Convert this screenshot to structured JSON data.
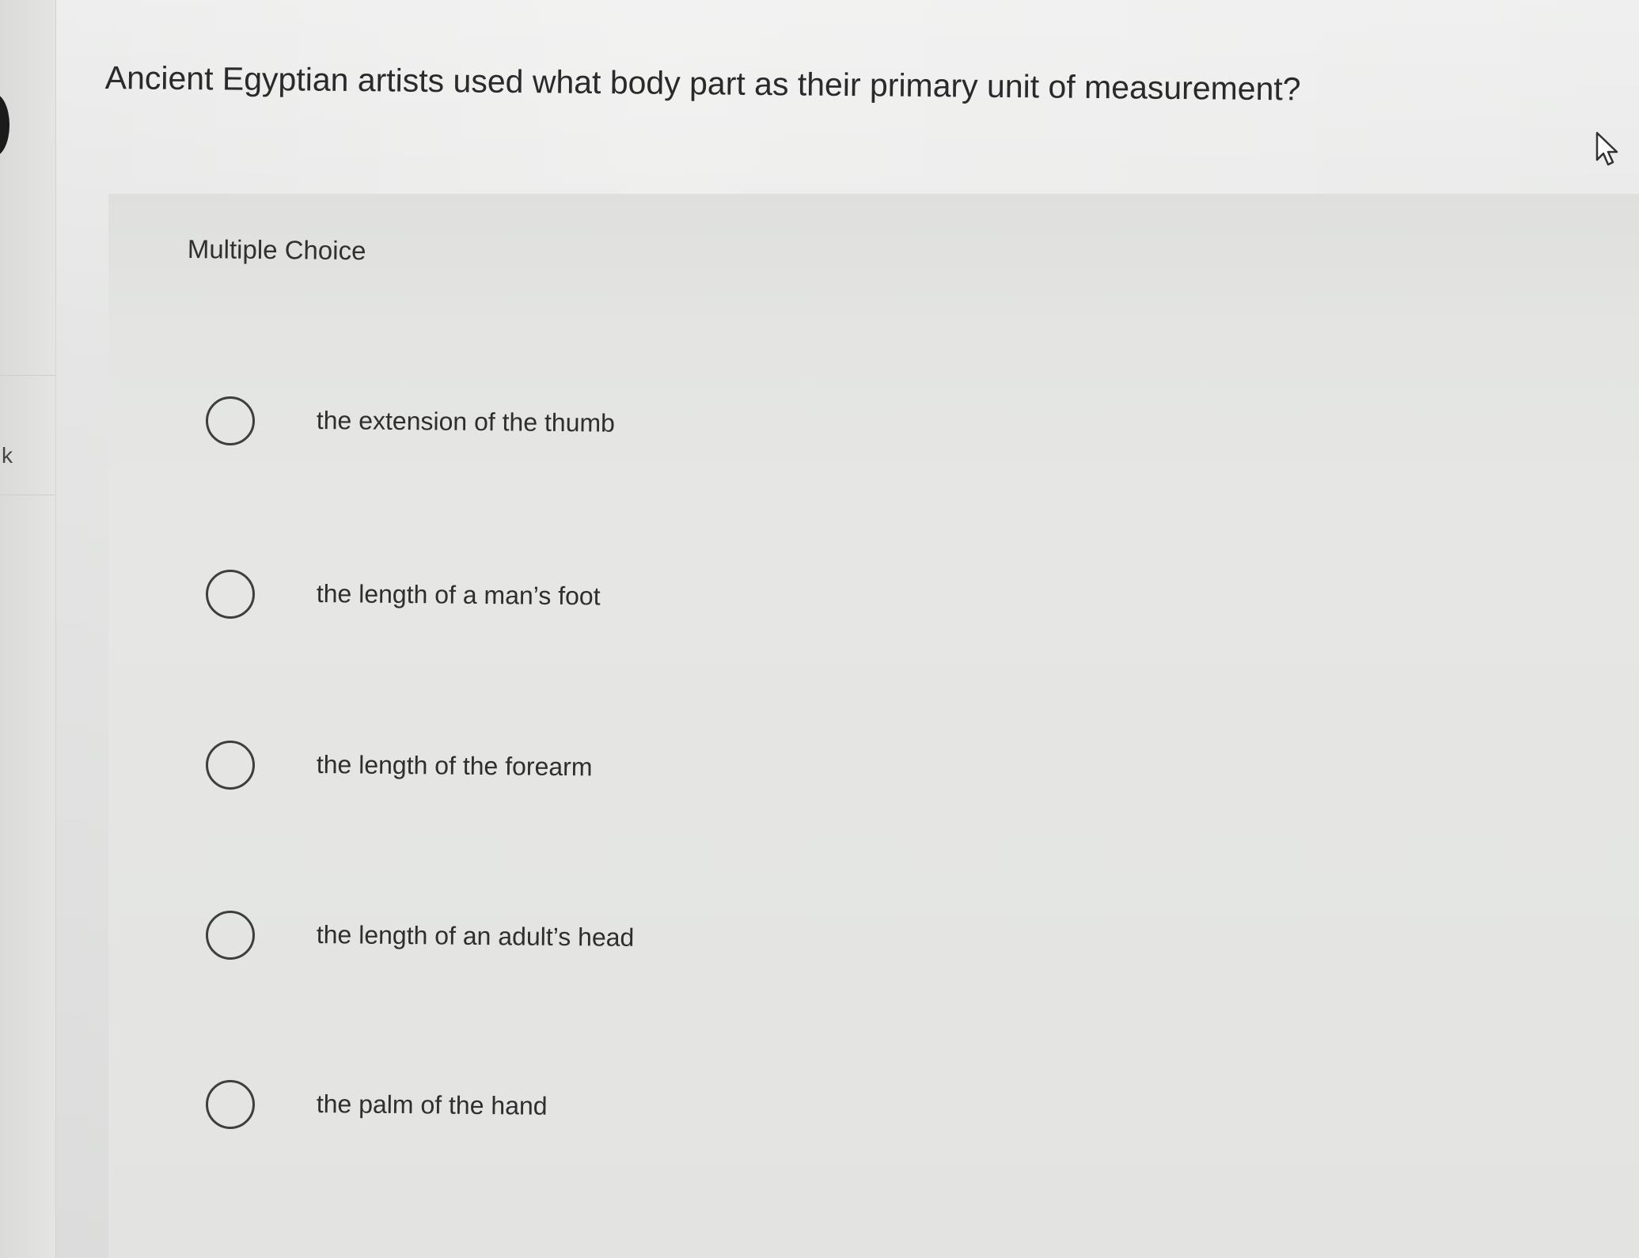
{
  "left_rail": {
    "letter": "k"
  },
  "question": {
    "text": "Ancient Egyptian artists used what body part as their primary unit of measurement?"
  },
  "choices": {
    "label": "Multiple Choice",
    "options": [
      {
        "label": "the extension of the thumb",
        "selected": false
      },
      {
        "label": "the length of a man’s foot",
        "selected": false
      },
      {
        "label": "the length of the forearm",
        "selected": false
      },
      {
        "label": "the length of an adult’s head",
        "selected": false
      },
      {
        "label": "the palm of the hand",
        "selected": false
      }
    ]
  },
  "icons": {
    "pointer": "mouse-pointer-icon",
    "radio": "radio-unchecked-icon"
  }
}
